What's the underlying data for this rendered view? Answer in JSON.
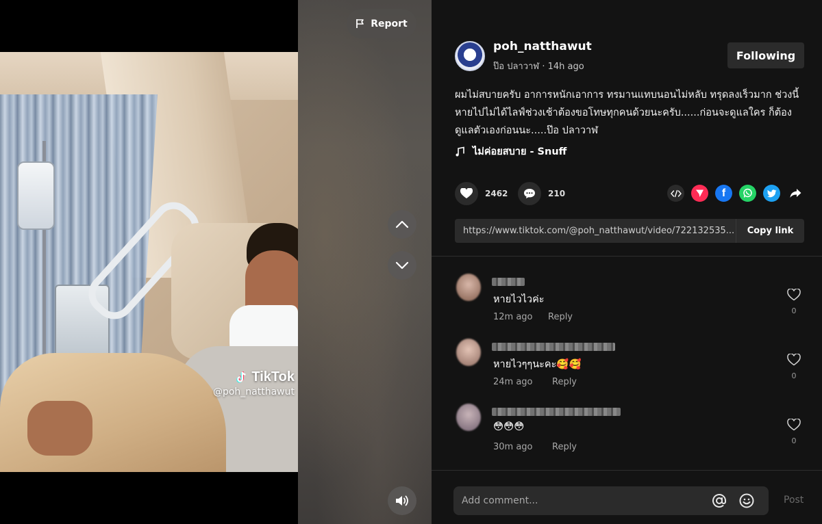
{
  "video": {
    "report_label": "Report",
    "watermark_brand": "TikTok",
    "watermark_handle": "@poh_natthawut"
  },
  "author": {
    "username": "poh_natthawut",
    "display_name": "ป๊อ ปลาวาฬ",
    "time_ago": "14h ago",
    "subtitle": "ป๊อ ปลาวาฬ · 14h ago",
    "follow_label": "Following"
  },
  "caption": "ผมไม่สบายครับ อาการหนักเอาการ ทรมานแทบนอนไม่หลับ ทรุดลงเร็วมาก ช่วงนี้หายไปไม่ได้ไลฟ์ช่วงเช้าต้องขอโทษทุกคนด้วยนะครับ......ก่อนจะดูแลใคร ก็ต้องดูแลตัวเองก่อนนะ.....ป๊อ ปลาวาฬ",
  "music": "ไม่ค่อยสบาย - Snuff",
  "stats": {
    "likes": "2462",
    "comments": "210"
  },
  "share": {
    "icons": [
      "embed-icon",
      "send-icon",
      "facebook-icon",
      "whatsapp-icon",
      "twitter-icon",
      "share-arrow-icon"
    ],
    "colors": {
      "send": "#fe2c55",
      "facebook": "#1877f2",
      "whatsapp": "#25d366",
      "twitter": "#1da1f2"
    },
    "link": "https://www.tiktok.com/@poh_natthawut/video/722132535...",
    "copy_label": "Copy link"
  },
  "comments": [
    {
      "text": "หายไวไวค่ะ",
      "time": "12m ago",
      "reply_label": "Reply",
      "likes": "0"
    },
    {
      "text": "หายไวๆๆนะคะ🥰🥰",
      "time": "24m ago",
      "reply_label": "Reply",
      "likes": "0"
    },
    {
      "text": "😳😳😳",
      "time": "30m ago",
      "reply_label": "Reply",
      "likes": "0"
    }
  ],
  "comment_input": {
    "placeholder": "Add comment...",
    "post_label": "Post"
  }
}
